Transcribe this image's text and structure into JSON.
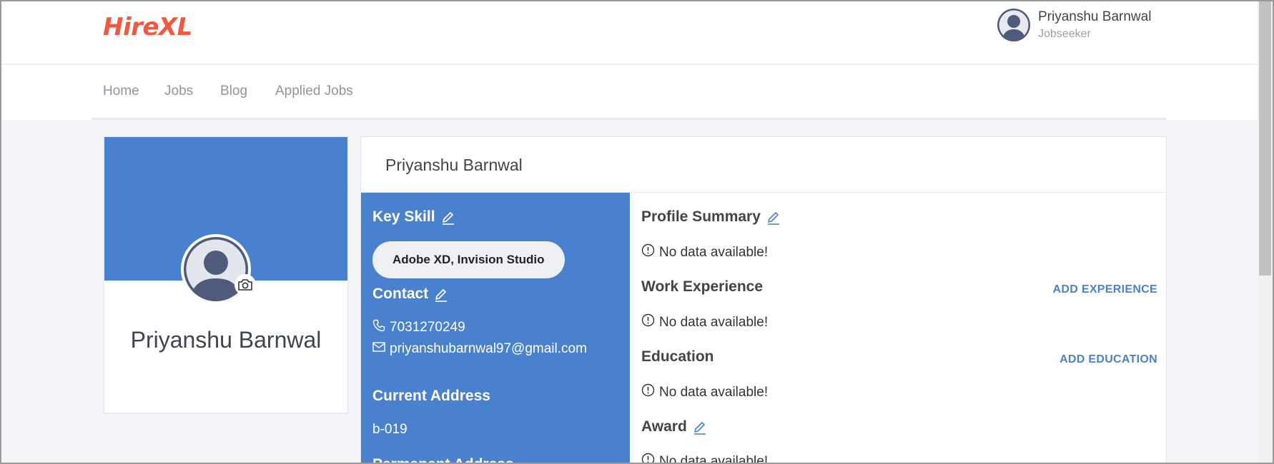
{
  "brand": {
    "logo": "HireXL",
    "accent": "#f2583e",
    "primary": "#4a81cf"
  },
  "user": {
    "name": "Priyanshu Barnwal",
    "role": "Jobseeker",
    "avatar_icon": "user-avatar-icon"
  },
  "nav": {
    "items": [
      {
        "label": "Home"
      },
      {
        "label": "Jobs"
      },
      {
        "label": "Blog"
      },
      {
        "label": "Applied Jobs"
      }
    ]
  },
  "profile_card": {
    "name": "Priyanshu Barnwal",
    "camera_icon": "camera-icon"
  },
  "details": {
    "title": "Priyanshu Barnwal",
    "key_skill": {
      "title": "Key Skill",
      "value": "Adobe XD, Invision Studio"
    },
    "contact": {
      "title": "Contact",
      "phone": "7031270249",
      "email": "priyanshubarnwal97@gmail.com"
    },
    "current_address": {
      "title": "Current Address",
      "value": "b-019"
    },
    "permanent_address": {
      "title": "Permanent Address"
    },
    "profile_summary": {
      "title": "Profile Summary",
      "empty": "No data available!"
    },
    "work_experience": {
      "title": "Work Experience",
      "empty": "No data available!",
      "action": "ADD EXPERIENCE"
    },
    "education": {
      "title": "Education",
      "empty": "No data available!",
      "action": "ADD EDUCATION"
    },
    "award": {
      "title": "Award",
      "empty": "No data available!"
    }
  }
}
